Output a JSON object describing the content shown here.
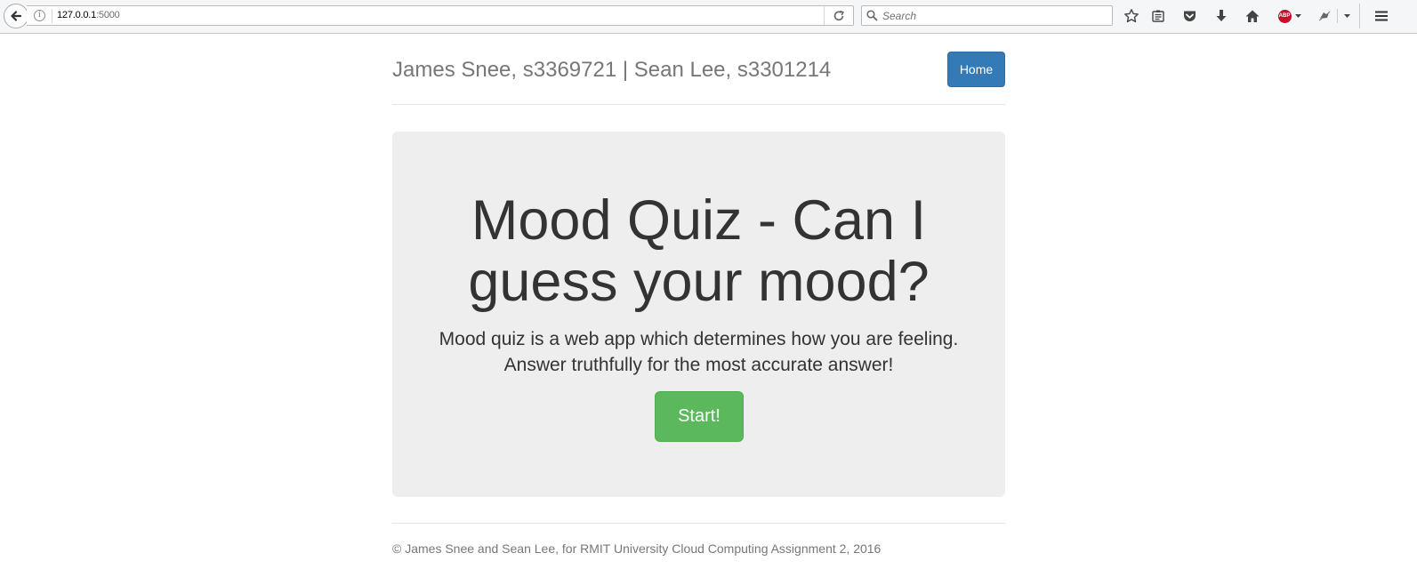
{
  "browser": {
    "url_host": "127.0.0.1",
    "url_port": ":5000",
    "search_placeholder": "Search",
    "abp_label": "ABP"
  },
  "header": {
    "title": "James Snee, s3369721 | Sean Lee, s3301214",
    "home_label": "Home"
  },
  "jumbotron": {
    "title": "Mood Quiz - Can I guess your mood?",
    "lead": "Mood quiz is a web app which determines how you are feeling. Answer truthfully for the most accurate answer!",
    "start_label": "Start!"
  },
  "footer": {
    "text": "© James Snee and Sean Lee, for RMIT University Cloud Computing Assignment 2, 2016"
  },
  "colors": {
    "primary": "#337ab7",
    "success": "#5cb85c",
    "jumbotron_bg": "#eeeeee",
    "muted_text": "#777777"
  },
  "icons": [
    "back-arrow-icon",
    "info-icon",
    "reload-icon",
    "search-icon",
    "star-icon",
    "reading-list-icon",
    "pocket-icon",
    "download-icon",
    "home-icon",
    "adblock-icon",
    "extension-icon",
    "dropdown-icon",
    "menu-icon"
  ]
}
